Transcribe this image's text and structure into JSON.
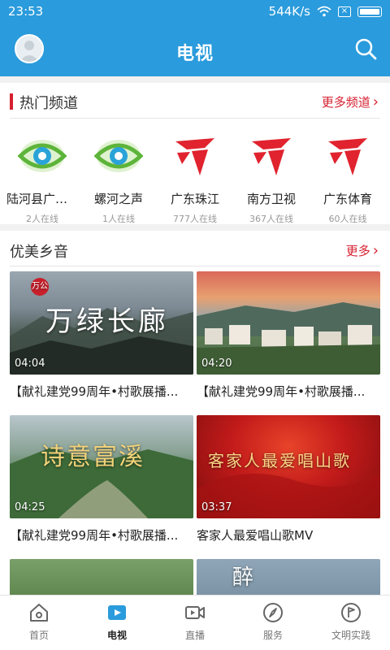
{
  "status": {
    "time": "23:53",
    "speed": "544K/s"
  },
  "header": {
    "title": "电视",
    "avatar_icon": "user-avatar",
    "search_icon": "search-icon"
  },
  "hot": {
    "title": "热门频道",
    "more": "更多频道",
    "channels": [
      {
        "name": "陆河县广播...",
        "online": "2人在线",
        "logo": "eye-logo"
      },
      {
        "name": "螺河之声",
        "online": "1人在线",
        "logo": "eye-logo"
      },
      {
        "name": "广东珠江",
        "online": "777人在线",
        "logo": "gdtv-logo"
      },
      {
        "name": "南方卫视",
        "online": "367人在线",
        "logo": "gdtv-logo"
      },
      {
        "name": "广东体育",
        "online": "60人在线",
        "logo": "gdtv-logo"
      }
    ]
  },
  "music": {
    "title": "优美乡音",
    "more": "更多",
    "videos": [
      {
        "title": "【献礼建党99周年•村歌展播...",
        "duration": "04:04",
        "overlay": "万绿长廊",
        "badge": "万公"
      },
      {
        "title": "【献礼建党99周年•村歌展播...",
        "duration": "04:20"
      },
      {
        "title": "【献礼建党99周年•村歌展播...",
        "duration": "04:25",
        "overlay": "诗意富溪"
      },
      {
        "title": "客家人最爱唱山歌MV",
        "duration": "03:37",
        "overlay": "客家人最爱唱山歌"
      },
      {
        "overlay": "醉"
      },
      {}
    ]
  },
  "nav": [
    {
      "label": "首页",
      "icon": "home-icon"
    },
    {
      "label": "电视",
      "icon": "tv-play-icon"
    },
    {
      "label": "直播",
      "icon": "video-camera-icon"
    },
    {
      "label": "服务",
      "icon": "compass-icon"
    },
    {
      "label": "文明实践",
      "icon": "flag-circle-icon"
    }
  ],
  "colors": {
    "primary": "#2a9bdc",
    "accent": "#d62030"
  }
}
